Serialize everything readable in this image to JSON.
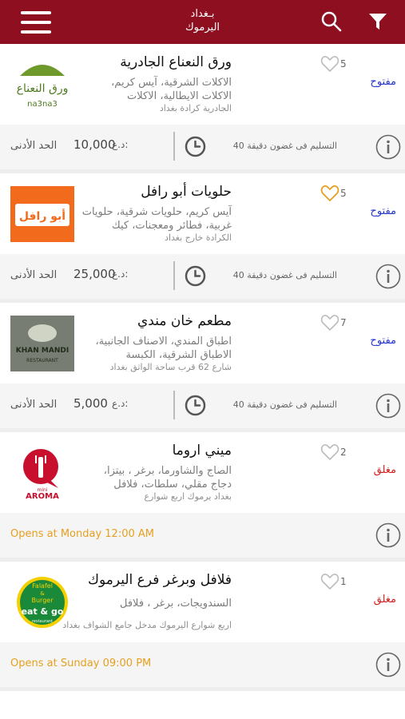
{
  "header": {
    "city": "بـغداد",
    "district": "اليرموك",
    "icons": [
      "menu-icon",
      "search-icon",
      "filter-icon"
    ]
  },
  "colors": {
    "brand": "#8e0f20",
    "open": "#2233cc",
    "closed": "#d21e1e",
    "opens_at": "#e6a020",
    "liked_heart": "#e6a020"
  },
  "restaurants": [
    {
      "name": "ورق النعناع الجادرية",
      "cuisine": "الاكلات الشرقية، آيس كريم، الاكلات الايطالية، الاكلات",
      "address": "الجادرية كرادة بغداد",
      "likes": "5",
      "status": "مفتوح",
      "currency": "د.ع:",
      "min_order": "10,000",
      "min_label": "الحد الأدنى",
      "delivery": "التسليم فى غضون دقيقة 40",
      "logo_text": "ورق النعناع",
      "logo_sub": "na3na3"
    },
    {
      "name": "حلويات أبو رافل",
      "cuisine": "آيس كريم، حلويات شرقية، حلويات غربية، فطائر ومعجنات، كيك",
      "address": "الكرادة خارج بغداد",
      "likes": "5",
      "status": "مفتوح",
      "currency": "د.ع:",
      "min_order": "25,000",
      "min_label": "الحد الأدنى",
      "delivery": "التسليم فى غضون دقيقة 40",
      "logo_text": "أبو رافل"
    },
    {
      "name": "مطعم خان مندي",
      "cuisine": "اطباق المندي، الاصناف الجانبية، الاطباق الشرقية، الكبسة",
      "address": "شارع 62 قرب ساحة الواثق بغداد",
      "likes": "7",
      "status": "مفتوح",
      "currency": "د.ع:",
      "min_order": "5,000",
      "min_label": "الحد الأدنى",
      "delivery": "التسليم فى غضون دقيقة 40",
      "logo_text": "KHAN MANDI",
      "logo_sub": "RESTAURANT"
    },
    {
      "name": "ميني اروما",
      "cuisine": "الصاج والشاورما، برغر ، بيتزا، دجاج مقلي، سلطات، فلافل",
      "address": "بغداد يرموك اربع شوارع",
      "likes": "2",
      "status": "مغلق",
      "opens_at": "Opens at Monday 12:00 AM",
      "logo_text": "AROMA",
      "logo_sub": "mini"
    },
    {
      "name": "فلافل وبرغر فرع اليرموك",
      "cuisine": "السندويجات، برغر ، فلافل",
      "address": "اربع شوارع اليرموك مدخل جامع الشواف بغداد",
      "likes": "1",
      "status": "مغلق",
      "opens_at": "Opens at Sunday 09:00 PM",
      "logo_text": "eat & go",
      "logo_top": "Falafel",
      "logo_mid": "&",
      "logo_bottom": "Burger",
      "logo_sub": "restaurant"
    }
  ]
}
